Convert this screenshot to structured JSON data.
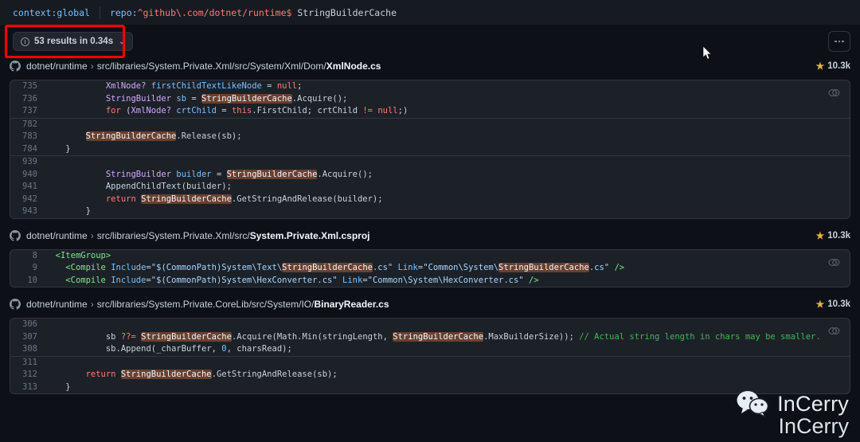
{
  "search": {
    "context_label": "context:global",
    "repo_qualifier_key": "repo:",
    "repo_qualifier_value": "^github\\.com/dotnet/runtime$",
    "query_term": "StringBuilderCache"
  },
  "toolbar": {
    "results_label": "53 results in 0.34s",
    "chevron": "⌄",
    "kebab_label": "More options"
  },
  "results": [
    {
      "repo": "dotnet/runtime",
      "separator": "›",
      "dir": "src/libraries/System.Private.Xml/src/System/Xml/Dom/",
      "file": "XmlNode.cs",
      "stars": "10.3k",
      "star_glyph": "★",
      "hunks": [
        {
          "lines": [
            {
              "num": "735",
              "html": "            <span class=\"t\">XmlNode?</span> <span class=\"id\">firstChildTextLikeNode</span> = <span class=\"k\">null</span>;"
            },
            {
              "num": "736",
              "html": "            <span class=\"t\">StringBuilder</span> <span class=\"id\">sb</span> = <span class=\"hl\">StringBuilderCache</span>.<span class=\"v\">Acquire</span>();"
            },
            {
              "num": "737",
              "html": "            <span class=\"k\">for</span> (<span class=\"t\">XmlNode?</span> <span class=\"id\">crtChild</span> = <span class=\"k\">this</span>.<span class=\"v\">FirstChild</span>; <span class=\"v\">crtChild</span> <span class=\"k\">!=</span> <span class=\"k\">null</span>;)"
            }
          ]
        },
        {
          "lines": [
            {
              "num": "782",
              "html": ""
            },
            {
              "num": "783",
              "html": "        <span class=\"hl\">StringBuilderCache</span>.<span class=\"v\">Release</span>(sb);"
            },
            {
              "num": "784",
              "html": "    }"
            }
          ]
        },
        {
          "lines": [
            {
              "num": "939",
              "html": ""
            },
            {
              "num": "940",
              "html": "            <span class=\"t\">StringBuilder</span> <span class=\"id\">builder</span> = <span class=\"hl\">StringBuilderCache</span>.<span class=\"v\">Acquire</span>();"
            },
            {
              "num": "941",
              "html": "            <span class=\"v\">AppendChildText</span>(builder);"
            },
            {
              "num": "942",
              "html": "            <span class=\"k\">return</span> <span class=\"hl\">StringBuilderCache</span>.<span class=\"v\">GetStringAndRelease</span>(builder);"
            },
            {
              "num": "943",
              "html": "        }"
            }
          ]
        }
      ]
    },
    {
      "repo": "dotnet/runtime",
      "separator": "›",
      "dir": "src/libraries/System.Private.Xml/src/",
      "file": "System.Private.Xml.csproj",
      "stars": "10.3k",
      "star_glyph": "★",
      "hunks": [
        {
          "lines": [
            {
              "num": "8",
              "html": "  <span class=\"tag\">&lt;ItemGroup&gt;</span>"
            },
            {
              "num": "9",
              "html": "    <span class=\"tag\">&lt;Compile</span> <span class=\"at\">Include</span>=<span class=\"s\">\"$(CommonPath)System\\Text\\</span><span class=\"hl\">StringBuilderCache</span><span class=\"s\">.cs\"</span> <span class=\"at\">Link</span>=<span class=\"s\">\"Common\\System\\</span><span class=\"hl\">StringBuilderCache</span><span class=\"s\">.cs\"</span> <span class=\"tag\">/&gt;</span>"
            },
            {
              "num": "10",
              "html": "    <span class=\"tag\">&lt;Compile</span> <span class=\"at\">Include</span>=<span class=\"s\">\"$(CommonPath)System\\HexConverter.cs\"</span> <span class=\"at\">Link</span>=<span class=\"s\">\"Common\\System\\HexConverter.cs\"</span> <span class=\"tag\">/&gt;</span>"
            }
          ]
        }
      ]
    },
    {
      "repo": "dotnet/runtime",
      "separator": "›",
      "dir": "src/libraries/System.Private.CoreLib/src/System/IO/",
      "file": "BinaryReader.cs",
      "stars": "10.3k",
      "star_glyph": "★",
      "hunks": [
        {
          "lines": [
            {
              "num": "306",
              "html": ""
            },
            {
              "num": "307",
              "html": "            <span class=\"v\">sb</span> <span class=\"k\">??=</span> <span class=\"hl\">StringBuilderCache</span>.<span class=\"v\">Acquire</span>(<span class=\"v\">Math</span>.<span class=\"v\">Min</span>(stringLength, <span class=\"hl\">StringBuilderCache</span>.<span class=\"v\">MaxBuilderSize</span>)); <span class=\"cm\">// Actual string length in chars may be smaller.</span>"
            },
            {
              "num": "308",
              "html": "            <span class=\"v\">sb</span>.<span class=\"v\">Append</span>(_charBuffer, <span class=\"n\">0</span>, charsRead);"
            }
          ]
        },
        {
          "lines": [
            {
              "num": "311",
              "html": ""
            },
            {
              "num": "312",
              "html": "        <span class=\"k\">return</span> <span class=\"hl\">StringBuilderCache</span>.<span class=\"v\">GetStringAndRelease</span>(sb);"
            },
            {
              "num": "313",
              "html": "    }"
            }
          ]
        }
      ]
    }
  ],
  "watermark": {
    "brand": "InCerry",
    "subtitle": "InCerry"
  },
  "colors": {
    "page_bg": "#0d1117",
    "code_bg": "#1c2128",
    "border": "#30363d",
    "highlight": "#e0703a",
    "star": "#e3b341",
    "annotation": "#ff0000"
  }
}
